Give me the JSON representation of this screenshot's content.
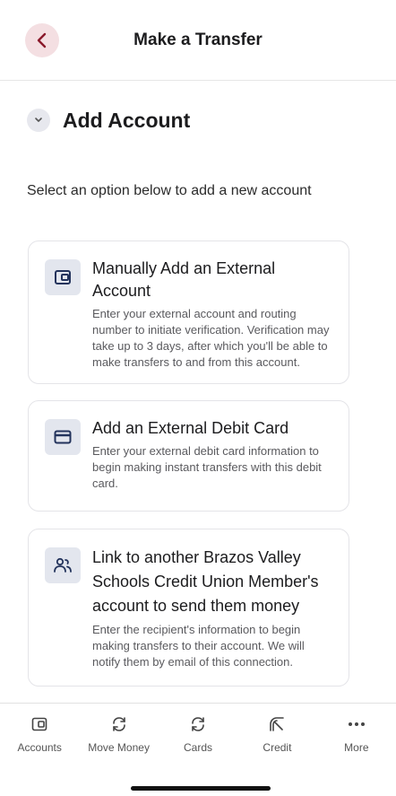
{
  "header": {
    "title": "Make a Transfer"
  },
  "section": {
    "title": "Add Account"
  },
  "instruction": "Select an option below to add a new account",
  "options": [
    {
      "title": "Manually Add an External Account",
      "description": "Enter your external account and routing number to initiate verification. Verification may take up to 3 days, after which you'll be able to make transfers to and from this account.",
      "icon": "wallet-icon"
    },
    {
      "title": "Add an External Debit Card",
      "description": "Enter your external debit card information to begin making instant transfers with this debit card.",
      "icon": "credit-card-icon"
    },
    {
      "title": "Link to another Brazos Valley Schools Credit Union Member's account to send them money",
      "description": "Enter the recipient's information to begin making transfers to their account. We will notify them by email of this connection.",
      "icon": "users-icon"
    }
  ],
  "nav": [
    {
      "label": "Accounts",
      "icon": "wallet-icon"
    },
    {
      "label": "Move Money",
      "icon": "transfer-icon"
    },
    {
      "label": "Cards",
      "icon": "transfer-icon"
    },
    {
      "label": "Credit",
      "icon": "gauge-icon"
    },
    {
      "label": "More",
      "icon": "more-icon"
    }
  ],
  "colors": {
    "accent": "#8b1a2b",
    "back_button_bg": "#f4dfe2",
    "icon_tile_bg": "#e3e6ee",
    "icon_color": "#23335c"
  }
}
